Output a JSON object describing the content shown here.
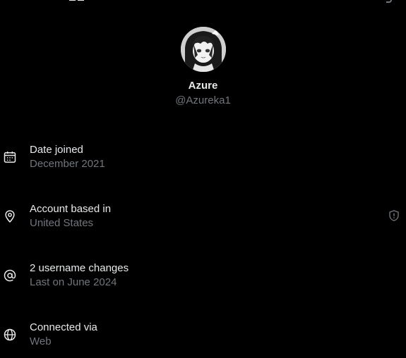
{
  "profile": {
    "display_name": "Azure",
    "handle": "@Azureka1"
  },
  "about": {
    "items": [
      {
        "icon": "calendar-icon",
        "label": "Date joined",
        "value": "December 2021"
      },
      {
        "icon": "location-pin-icon",
        "label": "Account based in",
        "value": "United States",
        "trailing_icon": "shield-icon"
      },
      {
        "icon": "at-sign-icon",
        "label": "2 username changes",
        "value": "Last on June 2024"
      },
      {
        "icon": "globe-icon",
        "label": "Connected via",
        "value": "Web"
      }
    ]
  },
  "colors": {
    "background": "#000000",
    "primary_text": "#e7e9ea",
    "secondary_text": "#71767b"
  }
}
